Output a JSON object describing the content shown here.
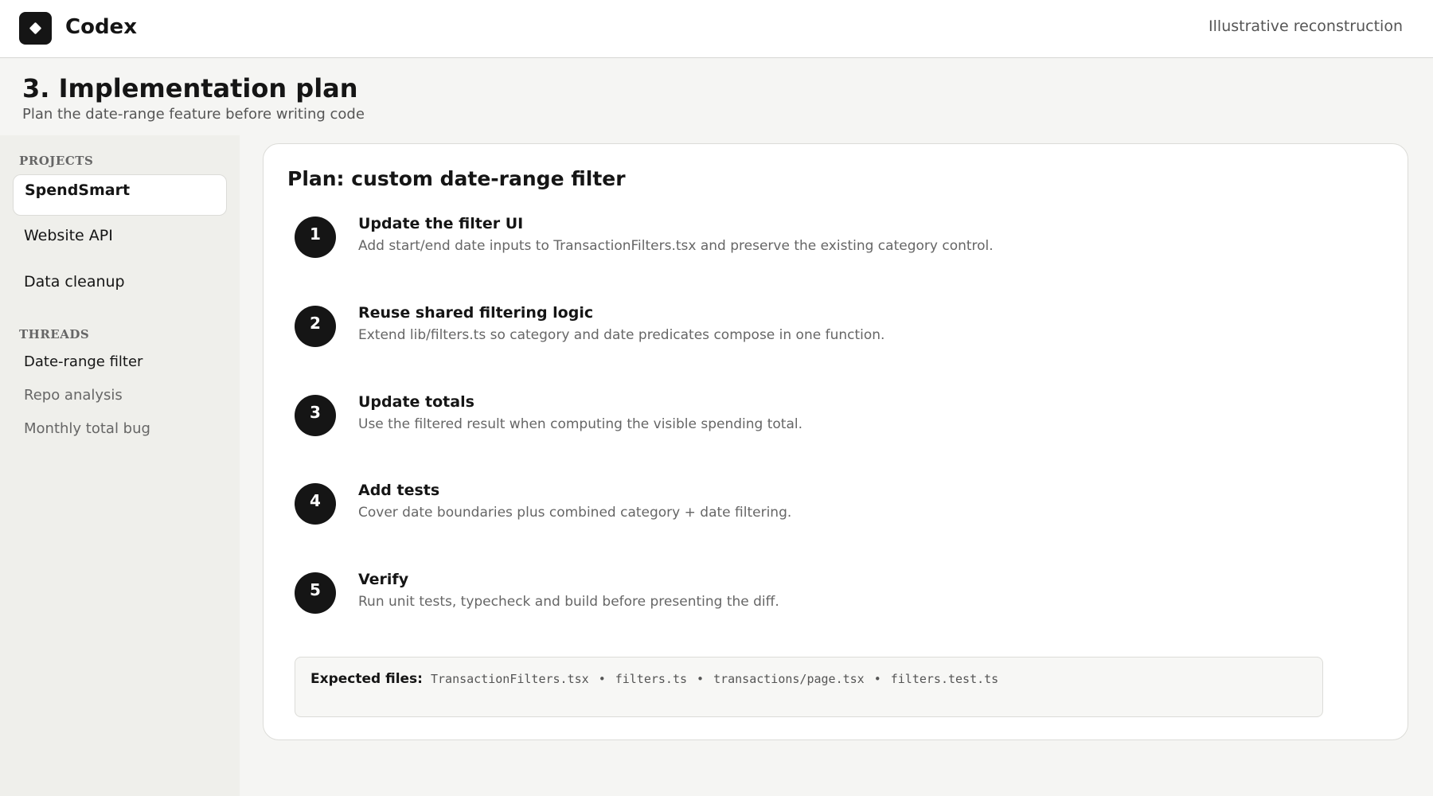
{
  "app": {
    "name": "Codex",
    "logo_icon": "diamond-icon",
    "note": "Illustrative reconstruction"
  },
  "header": {
    "title": "3. Implementation plan",
    "subtitle": "Plan the date-range feature before writing code"
  },
  "sidebar": {
    "projects_label": "PROJECTS",
    "projects": [
      {
        "label": "SpendSmart",
        "active": true
      },
      {
        "label": "Website API",
        "active": false
      },
      {
        "label": "Data cleanup",
        "active": false
      }
    ],
    "threads_label": "THREADS",
    "threads": [
      {
        "label": "Date-range filter",
        "active": true
      },
      {
        "label": "Repo analysis",
        "active": false
      },
      {
        "label": "Monthly total bug",
        "active": false
      }
    ]
  },
  "plan": {
    "title": "Plan: custom date-range filter",
    "steps": [
      {
        "number": "1",
        "title": "Update the filter UI",
        "description": "Add start/end date inputs to TransactionFilters.tsx and preserve the existing category control."
      },
      {
        "number": "2",
        "title": "Reuse shared filtering logic",
        "description": "Extend lib/filters.ts so category and date predicates compose in one function."
      },
      {
        "number": "3",
        "title": "Update totals",
        "description": "Use the filtered result when computing the visible spending total."
      },
      {
        "number": "4",
        "title": "Add tests",
        "description": "Cover date boundaries plus combined category + date filtering."
      },
      {
        "number": "5",
        "title": "Verify",
        "description": "Run unit tests, typecheck and build before presenting the diff."
      }
    ],
    "files_label": "Expected files:",
    "files": [
      "TransactionFilters.tsx",
      "filters.ts",
      "transactions/page.tsx",
      "filters.test.ts"
    ],
    "files_separator": "•"
  },
  "colors": {
    "accent": "#151515",
    "background": "#f5f5f3",
    "sidebar": "#efefeb",
    "card": "#ffffff",
    "muted_text": "#666666"
  }
}
